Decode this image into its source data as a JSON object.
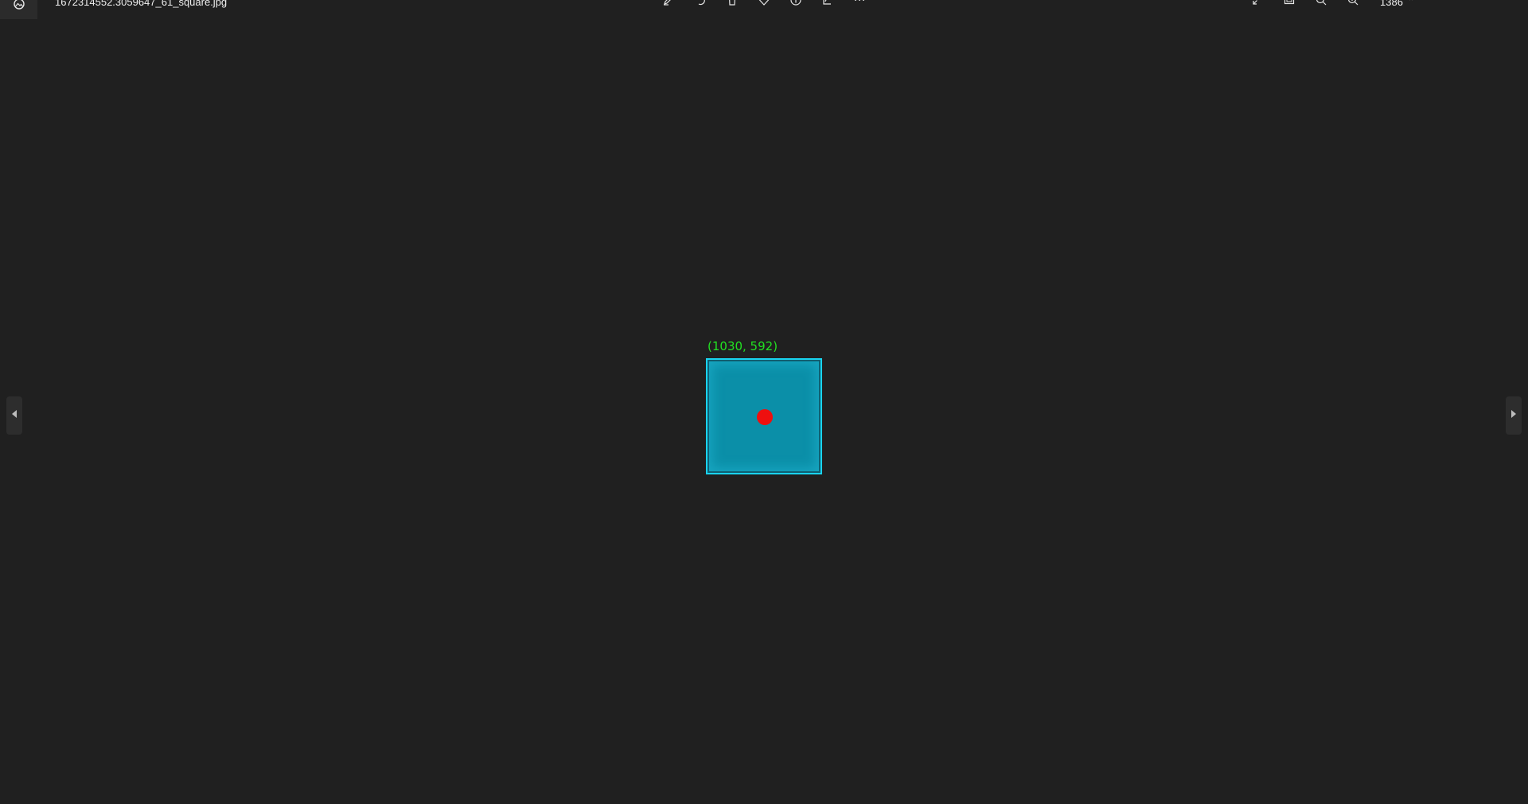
{
  "window": {
    "filename": "1672314552.3059647_61_square.jpg",
    "zoom_level": "1386",
    "zoom_chevron": "⌃"
  },
  "toolbar": {
    "left": [
      {
        "name": "photos-app-icon",
        "icon": "photos-icon"
      }
    ],
    "center": [
      {
        "name": "edit-image-button",
        "icon": "edit-icon"
      },
      {
        "name": "rotate-button",
        "icon": "rotate-icon"
      },
      {
        "name": "delete-button",
        "icon": "trash-icon"
      },
      {
        "name": "favorite-button",
        "icon": "heart-icon"
      },
      {
        "name": "file-info-button",
        "icon": "info-icon"
      },
      {
        "name": "share-button",
        "icon": "share-icon"
      },
      {
        "name": "see-more-button",
        "icon": "more-icon"
      }
    ],
    "right": [
      {
        "name": "full-screen-button",
        "icon": "expand-icon"
      },
      {
        "name": "fit-to-window-button",
        "icon": "fit-window-icon"
      },
      {
        "name": "zoom-out-button",
        "icon": "zoom-out-icon"
      },
      {
        "name": "zoom-in-button",
        "icon": "zoom-in-icon"
      }
    ]
  },
  "navigation": {
    "prev_icon": "triangle-left-icon",
    "next_icon": "triangle-right-icon"
  },
  "image": {
    "coordinate_label": "(1030, 592)",
    "label_color": "#22e022",
    "box_border_color": "#19d3ee",
    "box_fill_color": "#0b8fa8",
    "dot_color": "#ee0f0f"
  },
  "colors": {
    "background": "#202020",
    "toolbar_text": "#f0f0f0"
  }
}
